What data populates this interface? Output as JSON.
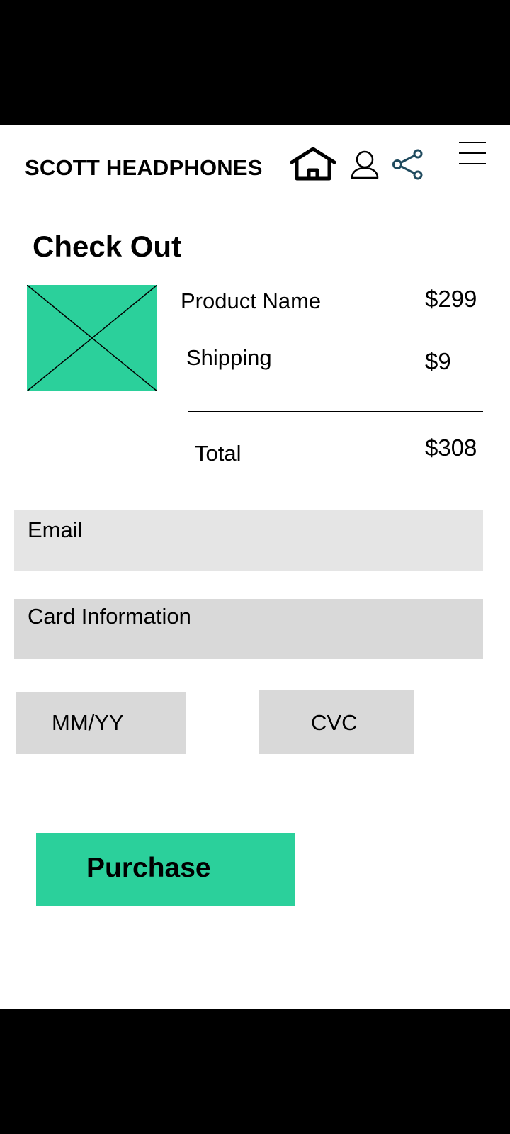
{
  "header": {
    "brand": "SCOTT HEADPHONES",
    "icons": [
      "home-icon",
      "user-icon",
      "share-icon",
      "menu-icon"
    ]
  },
  "page_title": "Check Out",
  "order": {
    "product_label": "Product Name",
    "product_price": "$299",
    "shipping_label": "Shipping",
    "shipping_price": "$9",
    "total_label": "Total",
    "total_price": "$308"
  },
  "form": {
    "email_placeholder": "Email",
    "card_placeholder": "Card Information",
    "expiry_placeholder": "MM/YY",
    "cvc_placeholder": "CVC"
  },
  "actions": {
    "purchase_label": "Purchase"
  },
  "colors": {
    "accent": "#2bd09b",
    "field_bg": "#d9d9d9",
    "email_field_bg": "#e5e5e5",
    "share_icon": "#1f4a5e"
  }
}
